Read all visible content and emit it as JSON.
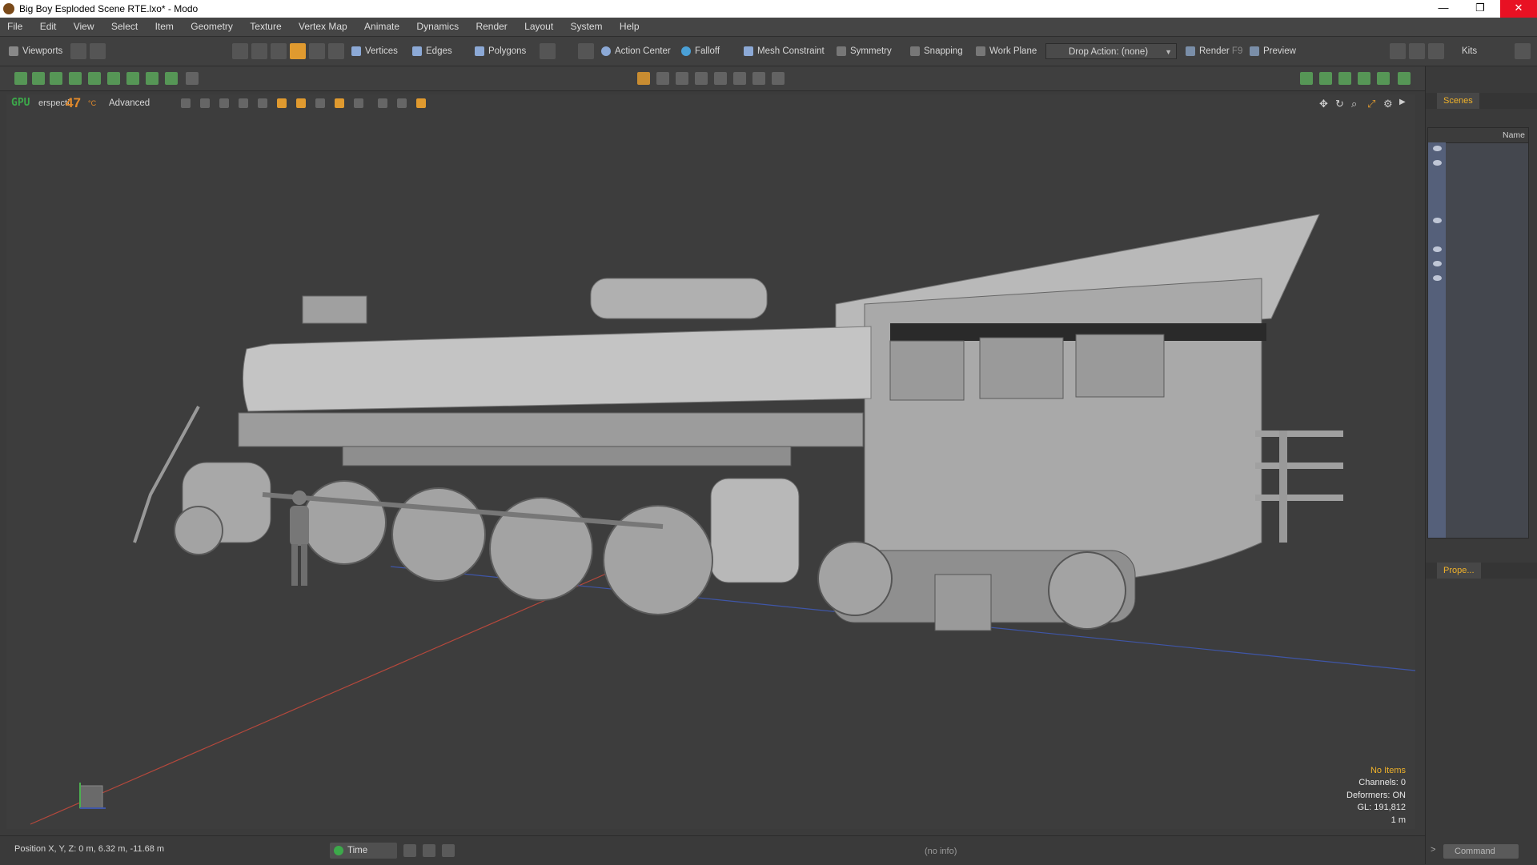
{
  "window": {
    "title": "Big Boy Esploded Scene RTE.lxo* - Modo",
    "minimize": "—",
    "restore": "❐",
    "close": "✕"
  },
  "menu": [
    "File",
    "Edit",
    "View",
    "Select",
    "Item",
    "Geometry",
    "Texture",
    "Vertex Map",
    "Animate",
    "Dynamics",
    "Render",
    "Layout",
    "System",
    "Help"
  ],
  "toolbar": {
    "viewports": "Viewports",
    "vertices": "Vertices",
    "edges": "Edges",
    "polygons": "Polygons",
    "action_center": "Action Center",
    "falloff": "Falloff",
    "mesh_constraint": "Mesh Constraint",
    "symmetry": "Symmetry",
    "snapping": "Snapping",
    "work_plane": "Work Plane",
    "drop_action": "Drop Action: (none)",
    "render": "Render",
    "render_key": "F9",
    "preview": "Preview",
    "kits": "Kits"
  },
  "viewport": {
    "gpu_label": "GPU",
    "gpu_number": "47",
    "gpu_unit": "°C",
    "view_name": "erspecti",
    "shading_mode": "Advanced"
  },
  "info": {
    "selection": "No Items",
    "channels": "Channels: 0",
    "deformers": "Deformers: ON",
    "gl": "GL: 191,812",
    "grid": "1 m"
  },
  "status": {
    "position": "Position X, Y, Z:   0 m, 6.32 m, -11.68 m",
    "time": "Time",
    "no_info": "(no info)"
  },
  "right_panel": {
    "scenes_tab": "Scenes",
    "name_header": "Name",
    "properties_tab": "Prope...",
    "command_placeholder": "Command"
  },
  "colors": {
    "accent": "#e09a2f",
    "gpu": "#3ca94a",
    "info_highlight": "#f0b22a",
    "close": "#e81123"
  }
}
